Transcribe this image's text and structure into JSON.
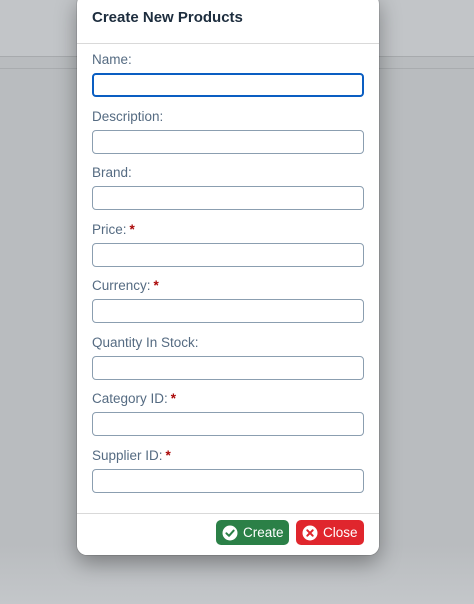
{
  "dialog": {
    "title": "Create New Products",
    "fields": [
      {
        "label": "Name:",
        "required": false,
        "value": "",
        "focused": true
      },
      {
        "label": "Description:",
        "required": false,
        "value": "",
        "focused": false
      },
      {
        "label": "Brand:",
        "required": false,
        "value": "",
        "focused": false
      },
      {
        "label": "Price:",
        "required": true,
        "value": "",
        "focused": false
      },
      {
        "label": "Currency:",
        "required": true,
        "value": "",
        "focused": false
      },
      {
        "label": "Quantity In Stock:",
        "required": false,
        "value": "",
        "focused": false
      },
      {
        "label": "Category ID:",
        "required": true,
        "value": "",
        "focused": false
      },
      {
        "label": "Supplier ID:",
        "required": true,
        "value": "",
        "focused": false
      }
    ],
    "required_marker": "*",
    "buttons": {
      "create": {
        "label": "Create",
        "icon": "check-circle-icon",
        "color": "#2b8047"
      },
      "close": {
        "label": "Close",
        "icon": "close-circle-icon",
        "color": "#e0262d"
      }
    }
  },
  "colors": {
    "title": "#1d2d3e",
    "label": "#556b82",
    "required": "#aa0808",
    "input_border": "#8b9eb0",
    "focus_border": "#0a5ec2",
    "overlay": "#b9bcbf"
  }
}
